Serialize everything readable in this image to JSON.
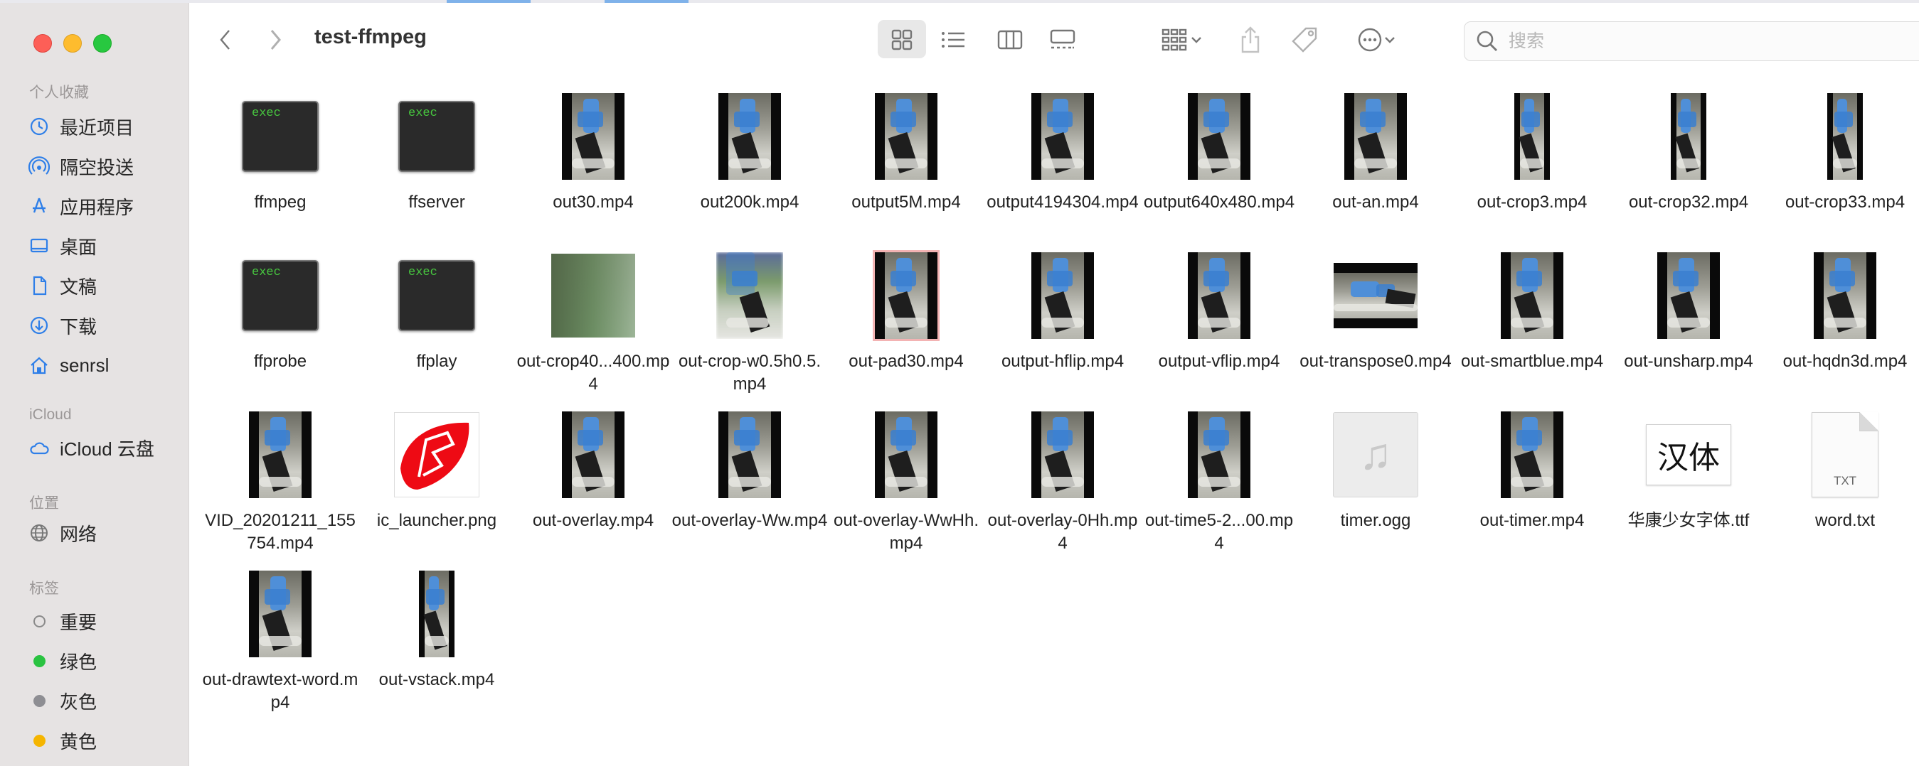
{
  "window": {
    "title": "test-ffmpeg"
  },
  "toolbar": {
    "back_icon": "chevron-left-icon",
    "forward_icon": "chevron-right-icon",
    "views": [
      "icon-view-icon",
      "list-view-icon",
      "column-view-icon",
      "gallery-view-icon"
    ],
    "active_view": "icon-view-icon",
    "search": {
      "placeholder": "搜索",
      "value": ""
    }
  },
  "sidebar": {
    "favorites_title": "个人收藏",
    "favorites": [
      {
        "label": "最近项目",
        "icon": "clock-icon"
      },
      {
        "label": "隔空投送",
        "icon": "airdrop-icon"
      },
      {
        "label": "应用程序",
        "icon": "applications-icon"
      },
      {
        "label": "桌面",
        "icon": "desktop-icon"
      },
      {
        "label": "文稿",
        "icon": "document-icon"
      },
      {
        "label": "下载",
        "icon": "download-icon"
      },
      {
        "label": "senrsl",
        "icon": "home-icon"
      }
    ],
    "icloud_title": "iCloud",
    "icloud": [
      {
        "label": "iCloud 云盘",
        "icon": "cloud-icon"
      }
    ],
    "locations_title": "位置",
    "locations": [
      {
        "label": "网络",
        "icon": "globe-icon"
      }
    ],
    "tags_title": "标签",
    "tags": [
      {
        "label": "重要",
        "color": ""
      },
      {
        "label": "绿色",
        "color": "#2ac341"
      },
      {
        "label": "灰色",
        "color": "#8e8e93"
      },
      {
        "label": "黄色",
        "color": "#f5b500"
      }
    ]
  },
  "files": [
    {
      "name": "ffmpeg",
      "kind": "exec",
      "badge": "exec"
    },
    {
      "name": "ffserver",
      "kind": "exec",
      "badge": "exec"
    },
    {
      "name": "out30.mp4",
      "kind": "video"
    },
    {
      "name": "out200k.mp4",
      "kind": "video"
    },
    {
      "name": "output5M.mp4",
      "kind": "video"
    },
    {
      "name": "output4194304.mp4",
      "kind": "video"
    },
    {
      "name": "output640x480.mp4",
      "kind": "video"
    },
    {
      "name": "out-an.mp4",
      "kind": "video"
    },
    {
      "name": "out-crop3.mp4",
      "kind": "video-narrow"
    },
    {
      "name": "out-crop32.mp4",
      "kind": "video-narrow"
    },
    {
      "name": "out-crop33.mp4",
      "kind": "video-narrow"
    },
    {
      "name": "ffprobe",
      "kind": "exec",
      "badge": "exec"
    },
    {
      "name": "ffplay",
      "kind": "exec",
      "badge": "exec"
    },
    {
      "name": "out-crop40...400.mp4",
      "kind": "video-crop"
    },
    {
      "name": "out-crop-w0.5h0.5.mp4",
      "kind": "video-cropw"
    },
    {
      "name": "out-pad30.mp4",
      "kind": "video-pad"
    },
    {
      "name": "output-hflip.mp4",
      "kind": "video"
    },
    {
      "name": "output-vflip.mp4",
      "kind": "video"
    },
    {
      "name": "out-transpose0.mp4",
      "kind": "video-wide"
    },
    {
      "name": "out-smartblue.mp4",
      "kind": "video"
    },
    {
      "name": "out-unsharp.mp4",
      "kind": "video"
    },
    {
      "name": "out-hqdn3d.mp4",
      "kind": "video"
    },
    {
      "name": "VID_20201211_155754.mp4",
      "kind": "video"
    },
    {
      "name": "ic_launcher.png",
      "kind": "png"
    },
    {
      "name": "out-overlay.mp4",
      "kind": "video"
    },
    {
      "name": "out-overlay-Ww.mp4",
      "kind": "video"
    },
    {
      "name": "out-overlay-WwHh.mp4",
      "kind": "video"
    },
    {
      "name": "out-overlay-0Hh.mp4",
      "kind": "video"
    },
    {
      "name": "out-time5-2...00.mp4",
      "kind": "video"
    },
    {
      "name": "timer.ogg",
      "kind": "audio"
    },
    {
      "name": "out-timer.mp4",
      "kind": "video"
    },
    {
      "name": "华康少女字体.ttf",
      "kind": "font",
      "preview": "汉体"
    },
    {
      "name": "word.txt",
      "kind": "text",
      "badge": "TXT"
    },
    {
      "name": "out-drawtext-word.mp4",
      "kind": "video"
    },
    {
      "name": "out-vstack.mp4",
      "kind": "video-narrow"
    }
  ]
}
